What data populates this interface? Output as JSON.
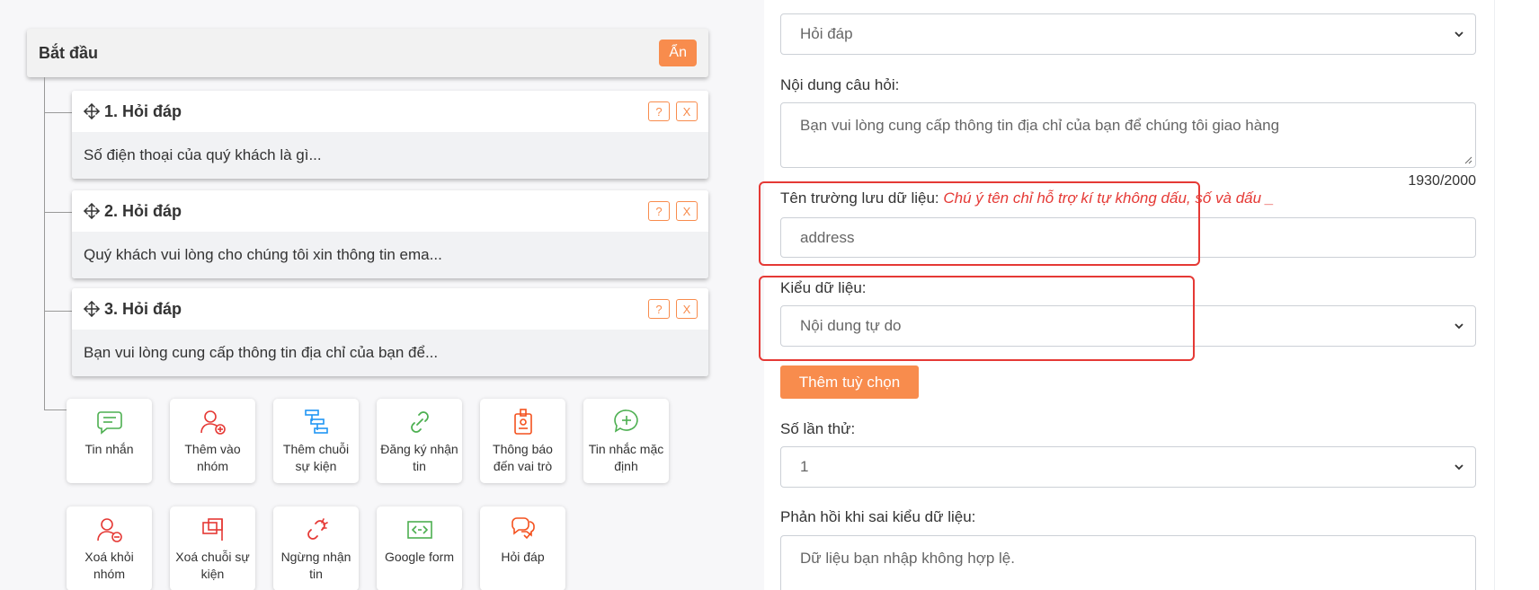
{
  "flow": {
    "start": {
      "title": "Bắt đầu",
      "hide_label": "Ẩn"
    },
    "steps": [
      {
        "title": "1. Hỏi đáp",
        "preview": "Số điện thoại của quý khách là gì...",
        "help": "?",
        "close": "X"
      },
      {
        "title": "2. Hỏi đáp",
        "preview": "Quý khách vui lòng cho chúng tôi xin thông tin ema...",
        "help": "?",
        "close": "X"
      },
      {
        "title": "3. Hỏi đáp",
        "preview": "Bạn vui lòng cung cấp thông tin địa chỉ của bạn để...",
        "help": "?",
        "close": "X"
      }
    ],
    "tiles": [
      {
        "label": "Tin nhắn",
        "icon": "message-icon",
        "color": "#4caf50"
      },
      {
        "label": "Thêm vào nhóm",
        "icon": "user-add-icon",
        "color": "#e53935"
      },
      {
        "label": "Thêm chuỗi sự kiện",
        "icon": "event-chain-icon",
        "color": "#2196f3"
      },
      {
        "label": "Đăng ký nhận tin",
        "icon": "link-icon",
        "color": "#4caf50"
      },
      {
        "label": "Thông báo đến vai trò",
        "icon": "badge-icon",
        "color": "#f4511e"
      },
      {
        "label": "Tin nhắc mặc định",
        "icon": "message-add-icon",
        "color": "#4caf50"
      },
      {
        "label": "Xoá khỏi nhóm",
        "icon": "user-remove-icon",
        "color": "#e53935"
      },
      {
        "label": "Xoá chuỗi sự kiện",
        "icon": "delete-chain-icon",
        "color": "#e53935"
      },
      {
        "label": "Ngừng nhận tin",
        "icon": "unlink-icon",
        "color": "#e53935"
      },
      {
        "label": "Google form",
        "icon": "form-icon",
        "color": "#4caf50"
      },
      {
        "label": "Hỏi đáp",
        "icon": "qa-icon",
        "color": "#f4511e"
      }
    ]
  },
  "form": {
    "type_value": "Hỏi đáp",
    "question_label": "Nội dung câu hỏi:",
    "question_value": "Bạn vui lòng cung cấp thông tin địa chỉ của bạn để chúng tôi giao hàng",
    "char_counter": "1930/2000",
    "field_name_label": "Tên trường lưu dữ liệu:",
    "field_name_note": "Chú ý tên chỉ hỗ trợ kí tự không dấu, số và dấu _",
    "field_name_value": "address",
    "data_type_label": "Kiểu dữ liệu:",
    "data_type_value": "Nội dung tự do",
    "add_option_label": "Thêm tuỳ chọn",
    "attempts_label": "Số lần thử:",
    "attempts_value": "1",
    "error_reply_label": "Phản hồi khi sai kiểu dữ liệu:",
    "error_reply_value": "Dữ liệu bạn nhập không hợp lệ."
  },
  "colors": {
    "accent": "#f88c4d",
    "highlight": "#e53935"
  }
}
